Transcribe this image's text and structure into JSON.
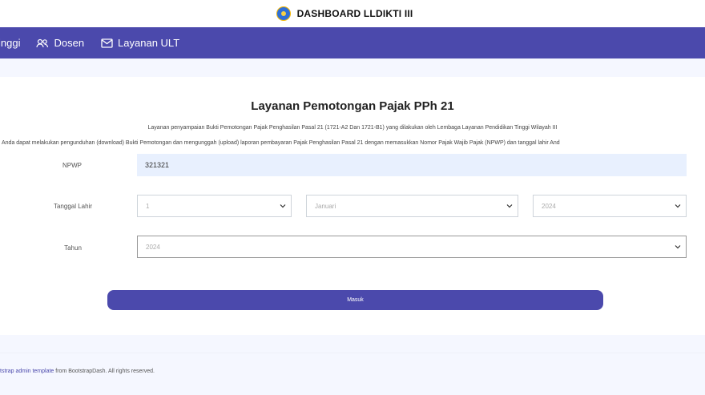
{
  "app": {
    "title": "DASHBOARD LLDIKTI III"
  },
  "nav": {
    "items": [
      {
        "label": "inggi",
        "icon": "none"
      },
      {
        "label": "Dosen",
        "icon": "users-icon"
      },
      {
        "label": "Layanan ULT",
        "icon": "mail-icon"
      }
    ]
  },
  "page": {
    "title": "Layanan Pemotongan Pajak PPh 21",
    "desc1": "Layanan penyampaian Bukti Pemotongan Pajak Penghasilan Pasal 21 (1721-A2 Dan 1721-B1) yang dilakukan oleh Lembaga Layanan Pendidikan Tinggi Wilayah III",
    "desc2": "Anda dapat melakukan pengunduhan (download) Bukti Pemotongan dan mengunggah (upload) laporan pembayaran Pajak Penghasilan Pasal 21 dengan memasukkan Nomor Pajak Wajib Pajak (NPWP) dan tanggal lahir And"
  },
  "form": {
    "npwp_label": "NPWP",
    "npwp_value": "321321",
    "dob_label": "Tanggal Lahir",
    "dob_day": "1",
    "dob_month": "Januari",
    "dob_year": "2024",
    "year_label": "Tahun",
    "year_value": "2024",
    "submit_label": "Masuk"
  },
  "footer": {
    "link": "tstrap admin template",
    "text": " from BootstrapDash. All rights reserved."
  },
  "colors": {
    "primary": "#4b49ac",
    "band": "#f5f7ff",
    "input_fill": "#e8f0fe"
  }
}
